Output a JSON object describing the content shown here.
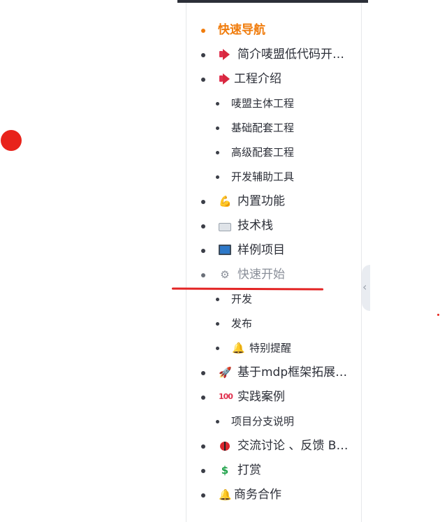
{
  "nav": {
    "items": [
      {
        "level": 1,
        "label": "快速导航",
        "icon": "",
        "state": "active"
      },
      {
        "level": 1,
        "label": "简介唛盟低代码开…",
        "icon": "megaphone-icon",
        "state": "normal"
      },
      {
        "level": 1,
        "label": "工程介绍",
        "icon": "megaphone-icon",
        "state": "normal"
      },
      {
        "level": 2,
        "label": "唛盟主体工程",
        "icon": "",
        "state": "normal"
      },
      {
        "level": 2,
        "label": "基础配套工程",
        "icon": "",
        "state": "normal"
      },
      {
        "level": 2,
        "label": "高级配套工程",
        "icon": "",
        "state": "normal"
      },
      {
        "level": 2,
        "label": "开发辅助工具",
        "icon": "",
        "state": "normal"
      },
      {
        "level": 1,
        "label": "内置功能",
        "icon": "flexed-arm-icon",
        "state": "normal"
      },
      {
        "level": 1,
        "label": "技术栈",
        "icon": "keyboard-icon",
        "state": "normal"
      },
      {
        "level": 1,
        "label": "样例项目",
        "icon": "laptop-icon",
        "state": "normal"
      },
      {
        "level": 1,
        "label": "快速开始",
        "icon": "gear-icon",
        "state": "muted"
      },
      {
        "level": 2,
        "label": "开发",
        "icon": "",
        "state": "normal"
      },
      {
        "level": 2,
        "label": "发布",
        "icon": "",
        "state": "normal"
      },
      {
        "level": 2,
        "label": "特别提醒",
        "icon": "bell-icon",
        "state": "normal"
      },
      {
        "level": 1,
        "label": "基于mdp框架拓展…",
        "icon": "rocket-icon",
        "state": "normal"
      },
      {
        "level": 1,
        "label": "实践案例",
        "icon": "hundred-points-icon",
        "state": "normal"
      },
      {
        "level": 2,
        "label": "项目分支说明",
        "icon": "",
        "state": "normal"
      },
      {
        "level": 1,
        "label": "交流讨论 、反馈 B…",
        "icon": "ladybug-icon",
        "state": "normal"
      },
      {
        "level": 1,
        "label": "打赏",
        "icon": "dollar-icon",
        "state": "normal"
      },
      {
        "level": 1,
        "label": "商务合作",
        "icon": "bell-icon",
        "state": "normal"
      }
    ]
  },
  "colors": {
    "active": "#f07c0c",
    "text": "#2c2f38",
    "muted": "#8a8f99",
    "annotation_red": "#e32424"
  },
  "collapse_handle": {
    "glyph": "‹"
  }
}
